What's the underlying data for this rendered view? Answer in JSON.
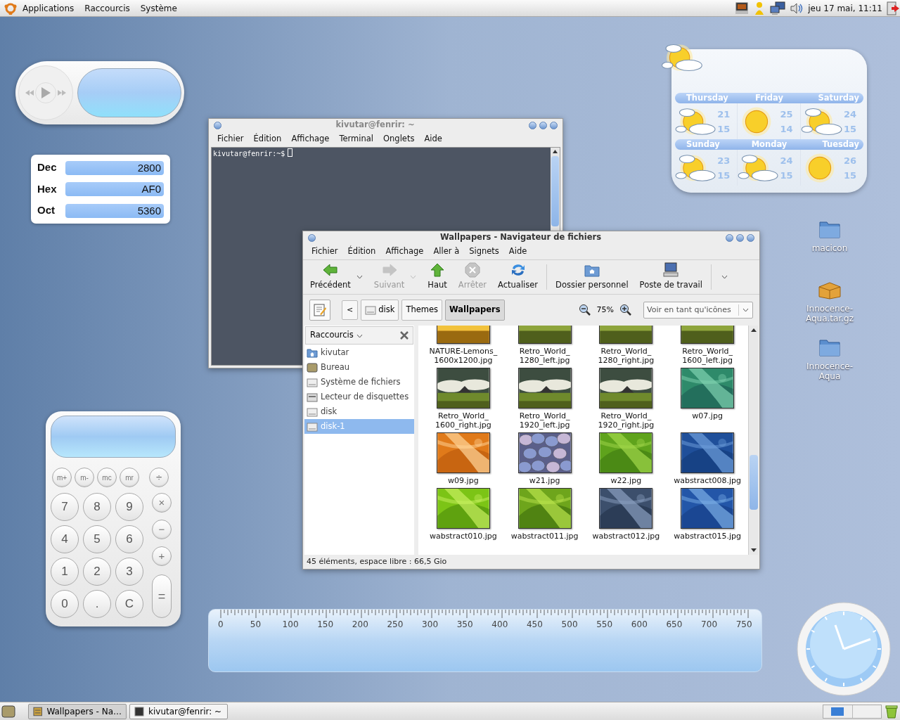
{
  "top_panel": {
    "menus": [
      "Applications",
      "Raccourcis",
      "Système"
    ],
    "clock": "jeu 17 mai, 11:11"
  },
  "converter": {
    "rows": [
      {
        "label": "Dec",
        "value": "2800"
      },
      {
        "label": "Hex",
        "value": "AF0"
      },
      {
        "label": "Oct",
        "value": "5360"
      }
    ]
  },
  "weather": {
    "days": [
      {
        "name": "Thursday",
        "high": "21",
        "low": "15",
        "kind": "partly_cloudy"
      },
      {
        "name": "Friday",
        "high": "25",
        "low": "14",
        "kind": "sunny"
      },
      {
        "name": "Saturday",
        "high": "24",
        "low": "15",
        "kind": "partly_cloudy"
      },
      {
        "name": "Sunday",
        "high": "23",
        "low": "15",
        "kind": "partly_cloudy"
      },
      {
        "name": "Monday",
        "high": "24",
        "low": "15",
        "kind": "partly_cloudy"
      },
      {
        "name": "Tuesday",
        "high": "26",
        "low": "15",
        "kind": "sunny"
      }
    ]
  },
  "terminal": {
    "title": "kivutar@fenrir: ~",
    "menus": [
      "Fichier",
      "Édition",
      "Affichage",
      "Terminal",
      "Onglets",
      "Aide"
    ],
    "prompt": "kivutar@fenrir:~$"
  },
  "file_manager": {
    "title": "Wallpapers - Navigateur de fichiers",
    "menus": [
      "Fichier",
      "Édition",
      "Affichage",
      "Aller à",
      "Signets",
      "Aide"
    ],
    "toolbar": [
      {
        "label": "Précédent",
        "kind": "back",
        "disabled": false,
        "dropdown": true
      },
      {
        "label": "Suivant",
        "kind": "forward",
        "disabled": true,
        "dropdown": true
      },
      {
        "label": "Haut",
        "kind": "up",
        "disabled": false,
        "dropdown": false
      },
      {
        "label": "Arrêter",
        "kind": "stop",
        "disabled": true,
        "dropdown": false
      },
      {
        "label": "Actualiser",
        "kind": "reload",
        "disabled": false,
        "dropdown": false
      },
      {
        "label": "Dossier personnel",
        "kind": "home",
        "disabled": false,
        "dropdown": false
      },
      {
        "label": "Poste de travail",
        "kind": "computer",
        "disabled": false,
        "dropdown": false
      }
    ],
    "back_button": "<",
    "path": [
      {
        "label": "disk",
        "selected": false,
        "drive": true
      },
      {
        "label": "Themes",
        "selected": false,
        "drive": false
      },
      {
        "label": "Wallpapers",
        "selected": true,
        "drive": false
      }
    ],
    "zoom": "75%",
    "view": "Voir en tant qu'icônes",
    "sidebar": {
      "title": "Raccourcis",
      "items": [
        {
          "label": "kivutar",
          "kind": "home",
          "selected": false
        },
        {
          "label": "Bureau",
          "kind": "desktop",
          "selected": false
        },
        {
          "label": "Système de fichiers",
          "kind": "drive",
          "selected": false
        },
        {
          "label": "Lecteur de disquettes",
          "kind": "floppy",
          "selected": false
        },
        {
          "label": "disk",
          "kind": "drive",
          "selected": false
        },
        {
          "label": "disk-1",
          "kind": "drive",
          "selected": true
        }
      ]
    },
    "files": [
      {
        "lines": [
          "NATURE-Lemons_",
          "1600x1200.jpg"
        ]
      },
      {
        "lines": [
          "Retro_World_",
          "1280_left.jpg"
        ]
      },
      {
        "lines": [
          "Retro_World_",
          "1280_right.jpg"
        ]
      },
      {
        "lines": [
          "Retro_World_",
          "1600_left.jpg"
        ]
      },
      {
        "lines": [
          "Retro_World_",
          "1600_right.jpg"
        ]
      },
      {
        "lines": [
          "Retro_World_",
          "1920_left.jpg"
        ]
      },
      {
        "lines": [
          "Retro_World_",
          "1920_right.jpg"
        ]
      },
      {
        "lines": [
          "w07.jpg"
        ]
      },
      {
        "lines": [
          "w09.jpg"
        ]
      },
      {
        "lines": [
          "w21.jpg"
        ]
      },
      {
        "lines": [
          "w22.jpg"
        ]
      },
      {
        "lines": [
          "wabstract008.jpg"
        ]
      },
      {
        "lines": [
          "wabstract010.jpg"
        ]
      },
      {
        "lines": [
          "wabstract011.jpg"
        ]
      },
      {
        "lines": [
          "wabstract012.jpg"
        ]
      },
      {
        "lines": [
          "wabstract015.jpg"
        ]
      }
    ],
    "status": "45 éléments, espace libre : 66,5 Gio"
  },
  "desktop_icons": [
    {
      "lines": [
        "macicon"
      ],
      "kind": "folder"
    },
    {
      "lines": [
        "Innocence-",
        "Aqua.tar.gz"
      ],
      "kind": "archive"
    },
    {
      "lines": [
        "Innocence-",
        "Aqua"
      ],
      "kind": "folder"
    }
  ],
  "calculator": {
    "top_keys": [
      "m+",
      "m-",
      "mc",
      "mr",
      "÷"
    ],
    "digit_keys": [
      "7",
      "8",
      "9",
      "4",
      "5",
      "6",
      "1",
      "2",
      "3",
      "0",
      ".",
      "C"
    ],
    "op_keys": [
      "×",
      "−",
      "+"
    ],
    "equals_key": "="
  },
  "ruler": {
    "ticks": [
      "0",
      "50",
      "100",
      "150",
      "200",
      "250",
      "300",
      "350",
      "400",
      "450",
      "500",
      "550",
      "600",
      "650",
      "700",
      "750"
    ]
  },
  "taskbar": {
    "tasks": [
      {
        "label": "Wallpapers - Na…",
        "kind": "files",
        "selected": true
      },
      {
        "label": "kivutar@fenrir: ~",
        "kind": "terminal",
        "selected": false
      }
    ]
  }
}
